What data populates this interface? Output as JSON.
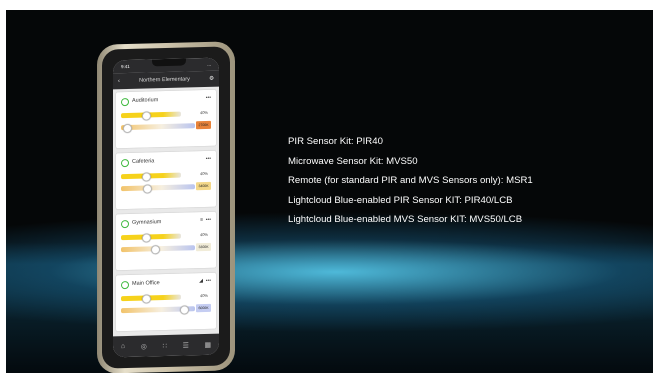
{
  "specs": [
    "PIR Sensor Kit: PIR40",
    "Microwave Sensor Kit: MVS50",
    "Remote (for standard PIR and MVS Sensors only): MSR1",
    "Lightcloud Blue-enabled PIR Sensor KIT: PIR40/LCB",
    "Lightcloud Blue-enabled MVS Sensor KIT: MVS50/LCB"
  ],
  "phone": {
    "status_time": "9:41",
    "status_icons": "...",
    "nav_title": "Northern Elementary",
    "rooms": [
      {
        "name": "Auditorium",
        "brightness_pct": "40%",
        "brightness": 0.4,
        "cct": "2700K",
        "cct_level": 0.08,
        "badge_color": "#e8833a",
        "signal": ""
      },
      {
        "name": "Cafeteria",
        "brightness_pct": "40%",
        "brightness": 0.4,
        "cct": "3400K",
        "cct_level": 0.35,
        "badge_color": "#f4d889",
        "signal": ""
      },
      {
        "name": "Gymnasium",
        "brightness_pct": "40%",
        "brightness": 0.4,
        "cct": "3300K",
        "cct_level": 0.45,
        "badge_color": "#f1ecd8",
        "signal": "≡"
      },
      {
        "name": "Main Office",
        "brightness_pct": "40%",
        "brightness": 0.4,
        "cct": "6000K",
        "cct_level": 0.85,
        "badge_color": "#c5cdf2",
        "signal": "◢"
      }
    ]
  }
}
